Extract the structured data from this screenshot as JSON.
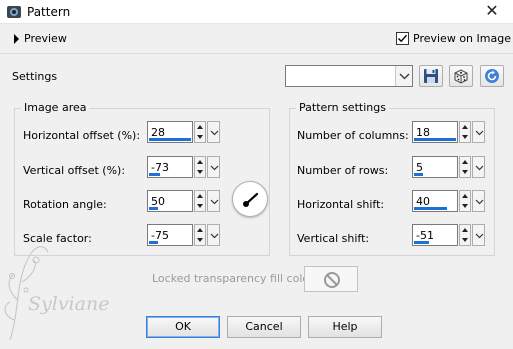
{
  "window": {
    "title": "Pattern",
    "close_glyph": "✕"
  },
  "preview": {
    "label": "Preview",
    "on_image_label": "Preview on Image",
    "on_image_checked": true
  },
  "settings": {
    "label": "Settings",
    "preset_value": ""
  },
  "image_area": {
    "title": "Image area",
    "horizontal_offset": {
      "label": "Horizontal offset (%):",
      "value": "28",
      "fill": 0.95
    },
    "vertical_offset": {
      "label": "Vertical offset (%):",
      "value": "-73",
      "fill": 0.25
    },
    "rotation_angle": {
      "label": "Rotation angle:",
      "value": "50",
      "fill": 0.2
    },
    "scale_factor": {
      "label": "Scale factor:",
      "value": "-75",
      "fill": 0.2
    }
  },
  "pattern_settings": {
    "title": "Pattern settings",
    "number_of_columns": {
      "label": "Number of columns:",
      "value": "18",
      "fill": 0.95
    },
    "number_of_rows": {
      "label": "Number of rows:",
      "value": "5",
      "fill": 0.2
    },
    "horizontal_shift": {
      "label": "Horizontal shift:",
      "value": "40",
      "fill": 0.75
    },
    "vertical_shift": {
      "label": "Vertical shift:",
      "value": "-51",
      "fill": 0.35
    }
  },
  "locked_fill": {
    "label": "Locked transparency fill color:"
  },
  "buttons": {
    "ok": "OK",
    "cancel": "Cancel",
    "help": "Help"
  },
  "watermark": {
    "text": "Sylviane"
  },
  "colors": {
    "accent": "#1e6fd6",
    "default_border": "#3c7fd6",
    "disabled_text": "#9a9a9a"
  },
  "icons": [
    "app-pattern-icon",
    "close-icon",
    "expand-triangle-icon",
    "checkmark-icon",
    "save-disk-icon",
    "dice-random-icon",
    "reset-arrow-icon",
    "rotation-dial-icon",
    "no-color-icon"
  ]
}
